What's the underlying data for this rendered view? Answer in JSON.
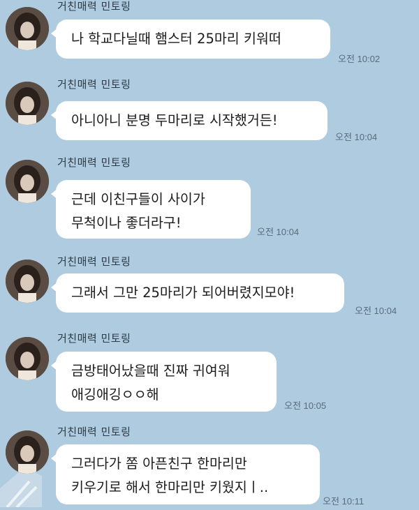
{
  "chat": {
    "messages": [
      {
        "sender": "거친매력 민토링",
        "lines": [
          "나 학교다닐때 햄스터 25마리 키워떠"
        ],
        "time": "오전 10:02"
      },
      {
        "sender": "거친매력 민토링",
        "lines": [
          "아니아니 분명 두마리로 시작했거든!"
        ],
        "time": "오전 10:04"
      },
      {
        "sender": "거친매력 민토링",
        "lines": [
          "근데 이친구들이 사이가",
          "무척이나 좋더라구!"
        ],
        "time": "오전 10:04"
      },
      {
        "sender": "거친매력 민토링",
        "lines": [
          "그래서 그만 25마리가 되어버렸지모야!"
        ],
        "time": "오전 10:04"
      },
      {
        "sender": "거친매력 민토링",
        "lines": [
          "금방태어났을때 진짜 귀여워",
          "애깅애깅ㅇㅇ해"
        ],
        "time": "오전 10:05"
      },
      {
        "sender": "거친매력 민토링",
        "lines": [
          "그러다가 쫌 아픈친구 한마리만",
          "키우기로 해서 한마리만 키웠지ㅣ.."
        ],
        "time": "오전 10:11"
      }
    ]
  },
  "colors": {
    "background": "#aecbe0",
    "bubble": "#ffffff",
    "time_text": "#5b6b78",
    "sender_text": "#2d3a44"
  }
}
